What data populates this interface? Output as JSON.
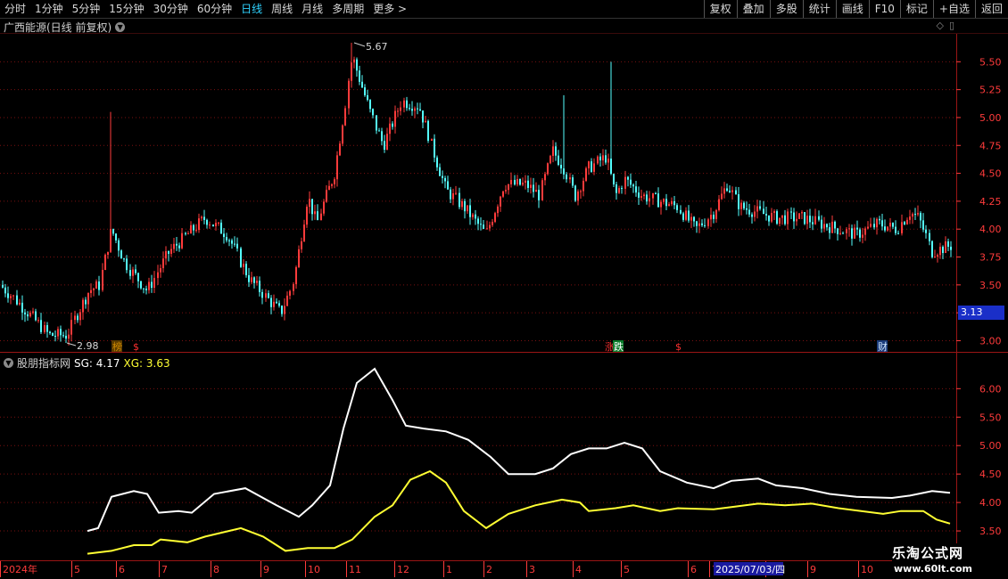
{
  "toolbar": {
    "periods": [
      "分时",
      "1分钟",
      "5分钟",
      "15分钟",
      "30分钟",
      "60分钟",
      "日线",
      "周线",
      "月线",
      "多周期",
      "更多 >"
    ],
    "active_period": "日线",
    "buttons": [
      "复权",
      "叠加",
      "多股",
      "统计",
      "画线",
      "F10",
      "标记",
      "+自选",
      "返回"
    ]
  },
  "kline": {
    "title": "广西能源(日线 前复权)",
    "high_label": "5.67",
    "low_label": "2.98",
    "price_tag": "3.13",
    "yticks": [
      "5.50",
      "5.25",
      "5.00",
      "4.75",
      "4.50",
      "4.25",
      "4.00",
      "3.75",
      "3.50",
      "3.25",
      "3.00"
    ],
    "markers": [
      {
        "text": "榜",
        "color": "#d08a00",
        "bg": "#5a3a00"
      },
      {
        "text": "$",
        "color": "#ff3030",
        "bg": ""
      },
      {
        "text": "涨",
        "color": "#ff3030",
        "bg": ""
      },
      {
        "text": "跌",
        "color": "#ffffff",
        "bg": "#0a7a2a"
      },
      {
        "text": "$",
        "color": "#ff3030",
        "bg": ""
      },
      {
        "text": "财",
        "color": "#cfe6ff",
        "bg": "#1a3a7a"
      }
    ]
  },
  "indicator": {
    "name": "股朋指标网",
    "sg_label": "SG: 4.17",
    "xg_label": "XG: 3.63",
    "yticks": [
      "6.00",
      "5.50",
      "5.00",
      "4.50",
      "4.00",
      "3.50"
    ]
  },
  "dates": [
    "2024年",
    "5",
    "6",
    "7",
    "8",
    "9",
    "10",
    "11",
    "12",
    "1",
    "2",
    "3",
    "4",
    "5",
    "6",
    "7",
    "8",
    "9",
    "10"
  ],
  "cursor_date": "2025/07/03/四",
  "watermark": {
    "line1": "乐淘公式网",
    "line2": "www.60lt.com"
  },
  "colors": {
    "up": "#ff3b3b",
    "down": "#54ffff",
    "sg": "#ffffff",
    "xg": "#ffff33",
    "grid": "#7a1010"
  },
  "chart_data": [
    {
      "type": "line",
      "title": "广西能源(日线 前复权)",
      "x": [
        "2024年",
        "5",
        "6",
        "7",
        "8",
        "9",
        "10",
        "11",
        "12",
        "1",
        "2",
        "3",
        "4",
        "5",
        "6",
        "7",
        "8",
        "9",
        "10"
      ],
      "series": [
        {
          "name": "",
          "values": [
            3.5,
            3.2,
            3.75,
            3.55,
            4.1,
            3.7,
            3.25,
            4.3,
            5.4,
            5.15,
            4.2,
            4.1,
            4.45,
            4.6,
            4.4,
            4.25,
            4.15,
            4.05,
            3.85
          ]
        }
      ],
      "ylim": [
        2.9,
        5.75
      ],
      "annotations": [
        "5.67",
        "2.98"
      ]
    },
    {
      "type": "line",
      "title": "股朋指标网",
      "x": [
        "2024年",
        "5",
        "6",
        "7",
        "8",
        "9",
        "10",
        "11",
        "12",
        "1",
        "2",
        "3",
        "4",
        "5",
        "6",
        "7",
        "8",
        "9",
        "10"
      ],
      "series": [
        {
          "name": "SG",
          "values": [
            3.5,
            4.15,
            3.82,
            4.2,
            3.82,
            3.9,
            6.35,
            5.25,
            4.5,
            4.5,
            4.95,
            5.0,
            4.55,
            4.25,
            4.4,
            4.25,
            4.15,
            4.05,
            4.17
          ]
        },
        {
          "name": "XG",
          "values": [
            3.1,
            3.25,
            3.28,
            3.4,
            3.45,
            3.15,
            3.5,
            4.55,
            3.55,
            3.9,
            4.05,
            3.9,
            3.95,
            3.9,
            3.95,
            3.9,
            3.85,
            3.8,
            3.63
          ]
        }
      ],
      "ylim": [
        3.0,
        6.6
      ]
    }
  ]
}
